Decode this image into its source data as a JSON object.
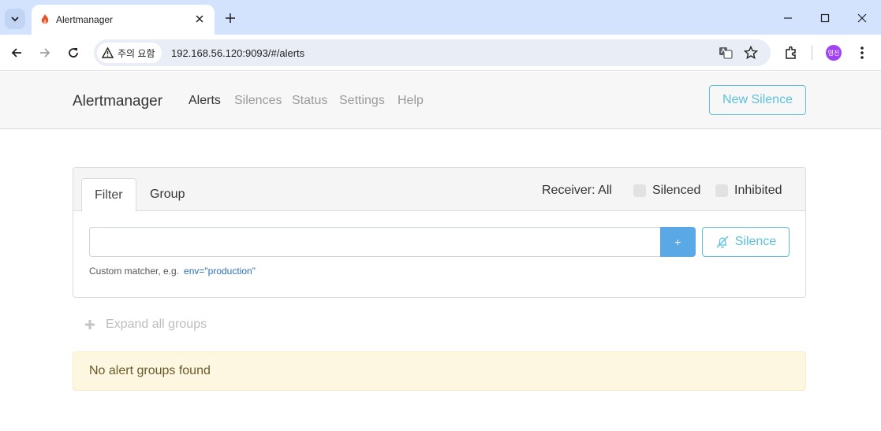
{
  "browser": {
    "tab_title": "Alertmanager",
    "security_label": "주의 요함",
    "url": "192.168.56.120:9093/#/alerts",
    "profile_initials": "영진"
  },
  "navbar": {
    "brand": "Alertmanager",
    "links": [
      "Alerts",
      "Silences",
      "Status",
      "Settings",
      "Help"
    ],
    "active_link": "Alerts",
    "new_silence_label": "New Silence"
  },
  "filter_panel": {
    "tabs": [
      "Filter",
      "Group"
    ],
    "receiver_label": "Receiver: All",
    "silenced_label": "Silenced",
    "inhibited_label": "Inhibited",
    "input_value": "",
    "add_label": "+",
    "silence_button_label": "Silence",
    "hint_prefix": "Custom matcher, e.g.",
    "hint_example": "env=\"production\""
  },
  "expand_label": "Expand all groups",
  "empty_message": "No alert groups found",
  "colors": {
    "accent": "#5bc0de",
    "add_button": "#5aa9e6",
    "warning_bg": "#fdf6e0"
  }
}
